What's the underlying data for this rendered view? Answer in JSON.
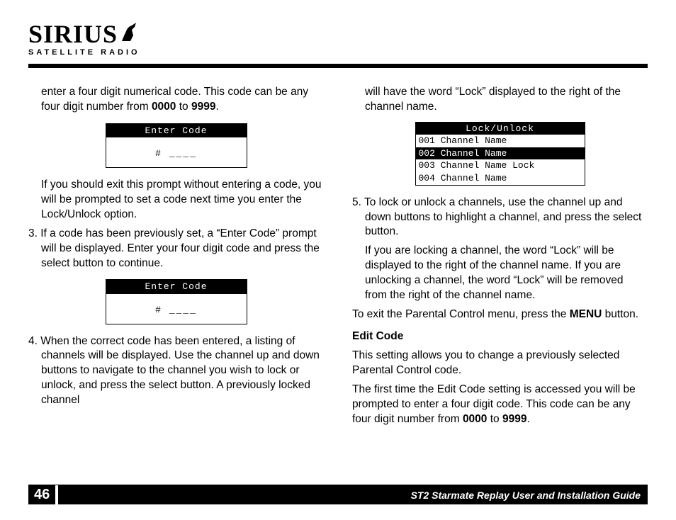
{
  "header": {
    "brand": "SIRIUS",
    "tagline": "SATELLITE RADIO"
  },
  "left": {
    "p1a": "enter a four digit numerical code. This code can be any four digit number from ",
    "p1b": "0000",
    "p1c": " to ",
    "p1d": "9999",
    "p1e": ".",
    "display1_title": "Enter Code",
    "display1_body": "# ____",
    "p2": "If you should exit this prompt without entering a code, you will be prompted to set a code next time you enter the Lock/Unlock option.",
    "p3": "3. If a code has been previously set, a “Enter Code” prompt will be displayed. Enter your four digit code and press the select button to continue.",
    "display2_title": "Enter Code",
    "display2_body": "# ____",
    "p4": "4. When the correct code has been entered, a listing of channels will be displayed. Use the channel up and down buttons to navigate to the channel you wish to lock or unlock, and press the select button. A previously locked channel"
  },
  "right": {
    "p1": "will have the word “Lock” displayed to the right of the channel name.",
    "lock_title": "Lock/Unlock",
    "rows": [
      {
        "num": "001",
        "name": "Channel Name",
        "tag": "",
        "sel": false
      },
      {
        "num": "002",
        "name": "Channel Name",
        "tag": "",
        "sel": true
      },
      {
        "num": "003",
        "name": "Channel Name",
        "tag": "Lock",
        "sel": false
      },
      {
        "num": "004",
        "name": "Channel Name",
        "tag": "",
        "sel": false
      }
    ],
    "p2": "5. To lock or unlock a channels, use the channel up and down buttons to highlight a channel, and press the select button.",
    "p3": "If you are locking a channel, the word “Lock” will be displayed to the right of the channel name. If you are unlocking a channel, the word “Lock” will be removed from the right of the channel name.",
    "p4a": "To exit the Parental Control menu, press the ",
    "p4b": "MENU",
    "p4c": " button.",
    "h1": "Edit Code",
    "p5": "This setting allows you to change a previously selected Parental Control code.",
    "p6a": "The first time the Edit Code setting is accessed you will be prompted to enter a four digit code. This code can be any four digit number from ",
    "p6b": "0000",
    "p6c": " to ",
    "p6d": "9999",
    "p6e": "."
  },
  "footer": {
    "page": "46",
    "title": "ST2 Starmate Replay User and Installation Guide"
  }
}
